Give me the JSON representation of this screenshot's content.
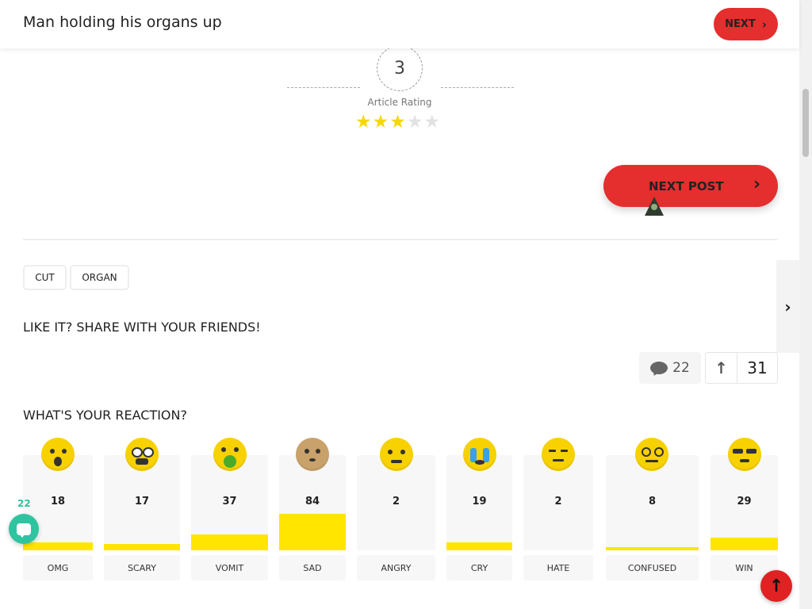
{
  "header": {
    "title": "Man holding his organs up",
    "next_label": "NEXT"
  },
  "rating": {
    "value": "3",
    "label": "Article Rating",
    "stars": 3,
    "max_stars": 5
  },
  "next_post_label": "NEXT POST",
  "tags": [
    "CUT",
    "ORGAN"
  ],
  "share": {
    "title": "LIKE IT? SHARE WITH YOUR FRIENDS!"
  },
  "stats": {
    "comments": "22",
    "votes": "31"
  },
  "reactions": {
    "title": "WHAT'S YOUR REACTION?",
    "items": [
      {
        "label": "OMG",
        "count": "18",
        "fill": 0.08
      },
      {
        "label": "SCARY",
        "count": "17",
        "fill": 0.07
      },
      {
        "label": "VOMIT",
        "count": "37",
        "fill": 0.17
      },
      {
        "label": "SAD",
        "count": "84",
        "fill": 0.38
      },
      {
        "label": "ANGRY",
        "count": "2",
        "fill": 0.0
      },
      {
        "label": "CRY",
        "count": "19",
        "fill": 0.08
      },
      {
        "label": "HATE",
        "count": "2",
        "fill": 0.0
      },
      {
        "label": "CONFUSED",
        "count": "8",
        "fill": 0.03
      },
      {
        "label": "WIN",
        "count": "29",
        "fill": 0.13
      }
    ]
  },
  "chat": {
    "badge": "22"
  },
  "colors": {
    "accent_red": "#e52e2e",
    "reaction_yellow": "#ffe500",
    "chat_teal": "#2fc4a0"
  }
}
